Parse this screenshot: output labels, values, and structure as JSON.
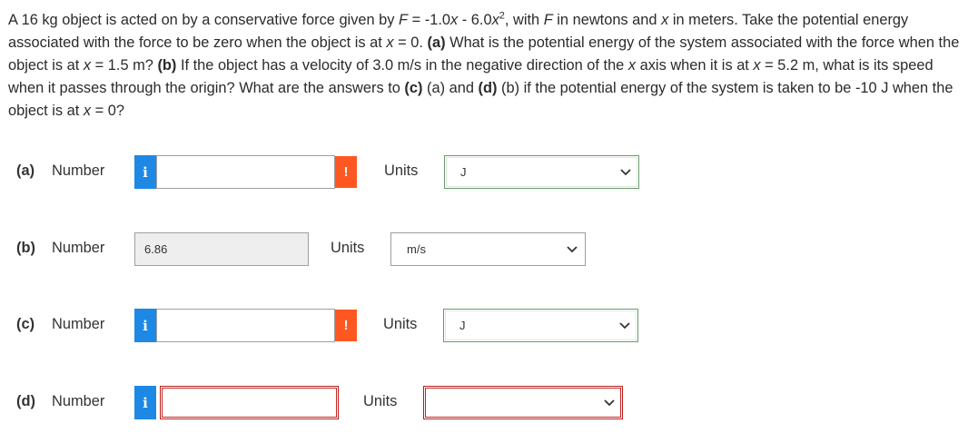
{
  "question": {
    "t1": "A 16 kg object is acted on by a conservative force given by ",
    "f_var": "F",
    "t2": " = -1.0",
    "x1": "x",
    "t3": " - 6.0",
    "x2": "x",
    "sup2": "2",
    "t4": ", with ",
    "f_var2": "F",
    "t5": " in newtons and ",
    "x3": "x",
    "t6": " in meters. Take the potential energy associated with the force to be zero when the object is at ",
    "x4": "x",
    "t7": " = 0. ",
    "a_label": "(a)",
    "t8": " What is the potential energy of the system associated with the force when the object is at ",
    "x5": "x",
    "t9": " = 1.5 m? ",
    "b_label": "(b)",
    "t10": " If the object has a velocity of 3.0 m/s in the negative direction of the ",
    "x6": "x",
    "t11": " axis when it is at ",
    "x7": "x",
    "t12": " = 5.2 m, what is its speed when it passes through the origin? What are the answers to ",
    "c_label": "(c)",
    "t13": " (a) and ",
    "d_label": "(d)",
    "t14": " (b) if the potential energy of the system is taken to be -10 J when the object is at ",
    "x8": "x",
    "t15": " = 0?"
  },
  "rows": [
    {
      "part": "(a)",
      "number_label": "Number",
      "info": "i",
      "value": "",
      "warn": "!",
      "units_label": "Units",
      "unit": "J"
    },
    {
      "part": "(b)",
      "number_label": "Number",
      "value": "6.86",
      "units_label": "Units",
      "unit": "m/s"
    },
    {
      "part": "(c)",
      "number_label": "Number",
      "info": "i",
      "value": "",
      "warn": "!",
      "units_label": "Units",
      "unit": "J"
    },
    {
      "part": "(d)",
      "number_label": "Number",
      "info": "i",
      "value": "",
      "units_label": "Units",
      "unit": ""
    }
  ],
  "colors": {
    "info_blue": "#1e88e5",
    "warn_orange": "#ff5722",
    "error_red": "#c62828",
    "ok_green": "#6b9a6b"
  },
  "icons": {
    "info": "info-icon",
    "warn": "exclamation-icon",
    "chevron": "chevron-down-icon"
  }
}
